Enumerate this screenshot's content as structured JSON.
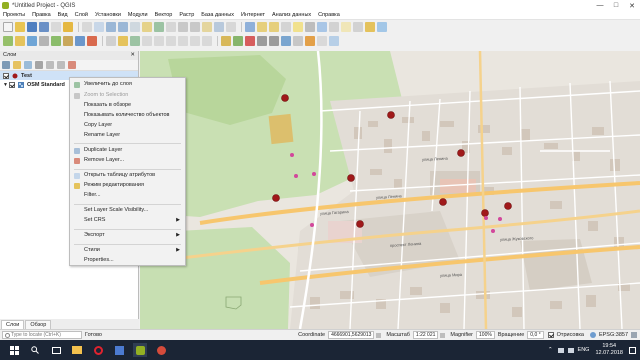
{
  "window": {
    "title": "*Untitled Project - QGIS"
  },
  "menu": [
    "Проекты",
    "Правка",
    "Вид",
    "Слой",
    "Установки",
    "Модули",
    "Вектор",
    "Растр",
    "База данных",
    "Интернет",
    "Анализ данных",
    "Справка"
  ],
  "layers_panel": {
    "title": "Слои",
    "layers": [
      {
        "name": "Test",
        "selected": true
      },
      {
        "name": "OSM Standard",
        "selected": false
      }
    ]
  },
  "context_menu": {
    "items": [
      {
        "label": "Увеличить до слоя",
        "disabled": false,
        "icon": "zoom-to-layer-icon",
        "submenu": false
      },
      {
        "label": "Zoom to Selection",
        "disabled": true,
        "icon": "zoom-to-selection-icon",
        "submenu": false
      },
      {
        "label": "Показать в обзоре",
        "disabled": false,
        "icon": "",
        "submenu": false
      },
      {
        "label": "Показывать количество объектов",
        "disabled": false,
        "icon": "",
        "submenu": false
      },
      {
        "label": "Copy Layer",
        "disabled": false,
        "icon": "",
        "submenu": false
      },
      {
        "label": "Rename Layer",
        "disabled": false,
        "icon": "",
        "submenu": false
      },
      {
        "label": "Duplicate Layer",
        "disabled": false,
        "icon": "duplicate-icon",
        "submenu": false
      },
      {
        "label": "Remove Layer...",
        "disabled": false,
        "icon": "remove-icon",
        "submenu": false
      },
      {
        "label": "Открыть таблицу атрибутов",
        "disabled": false,
        "icon": "table-icon",
        "submenu": false
      },
      {
        "label": "Режим редактирования",
        "disabled": false,
        "icon": "pencil-icon",
        "submenu": false
      },
      {
        "label": "Filter...",
        "disabled": false,
        "icon": "",
        "submenu": false
      },
      {
        "label": "Set Layer Scale Visibility...",
        "disabled": false,
        "icon": "",
        "submenu": false
      },
      {
        "label": "Set CRS",
        "disabled": false,
        "icon": "",
        "submenu": true
      },
      {
        "label": "Экспорт",
        "disabled": false,
        "icon": "",
        "submenu": true
      },
      {
        "label": "Стили",
        "disabled": false,
        "icon": "",
        "submenu": true
      },
      {
        "label": "Properties...",
        "disabled": false,
        "icon": "",
        "submenu": false
      }
    ]
  },
  "tabs": [
    "Слои",
    "Обзор"
  ],
  "status": {
    "locate_placeholder": "Type to locate (Ctrl+K)",
    "ready": "Готово",
    "coordinate_label": "Coordinate",
    "coordinate_value": "4666901,5629013",
    "scale_label": "Масштаб",
    "scale_value": "1:22 021",
    "magnifier_label": "Magnifier",
    "magnifier_value": "100%",
    "rotation_label": "Вращение",
    "rotation_value": "0,0 °",
    "render_label": "Отрисовка",
    "crs": "EPSG:3857"
  },
  "taskbar": {
    "lang": "ENG",
    "time": "19:54",
    "date": "12.07.2018"
  },
  "map": {
    "street_labels": [
      "улица Ленина",
      "улица Ленина",
      "проспект Ленина",
      "улица Жуковского",
      "улица Гагарина",
      "улица Мира"
    ],
    "point_count": 9,
    "poi_count": 7
  }
}
